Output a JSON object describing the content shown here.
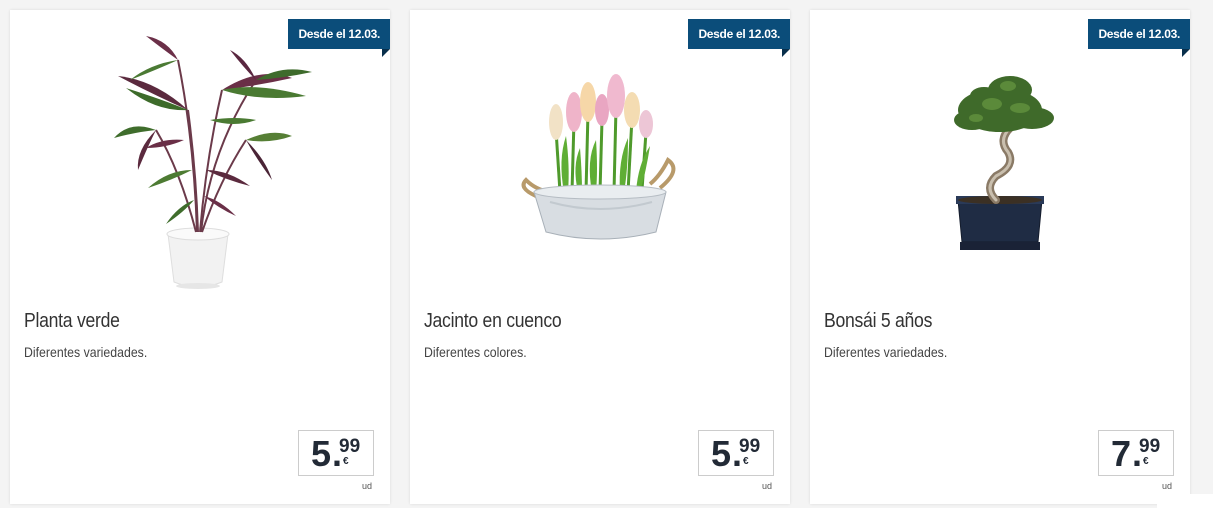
{
  "products": [
    {
      "badge": "Desde el 12.03.",
      "title": "Planta verde",
      "description": "Diferentes variedades.",
      "price_int": "5",
      "price_dec": "99",
      "currency": "€",
      "unit": "ud",
      "image_icon": "plant-image"
    },
    {
      "badge": "Desde el 12.03.",
      "title": "Jacinto en cuenco",
      "description": "Diferentes colores.",
      "price_int": "5",
      "price_dec": "99",
      "currency": "€",
      "unit": "ud",
      "image_icon": "hyacinth-image"
    },
    {
      "badge": "Desde el 12.03.",
      "title": "Bonsái 5 años",
      "description": "Diferentes variedades.",
      "price_int": "7",
      "price_dec": "99",
      "currency": "€",
      "unit": "ud",
      "image_icon": "bonsai-image"
    }
  ],
  "colors": {
    "badge_bg": "#0b4d7a",
    "price_text": "#222a36",
    "title_text": "#333333"
  }
}
